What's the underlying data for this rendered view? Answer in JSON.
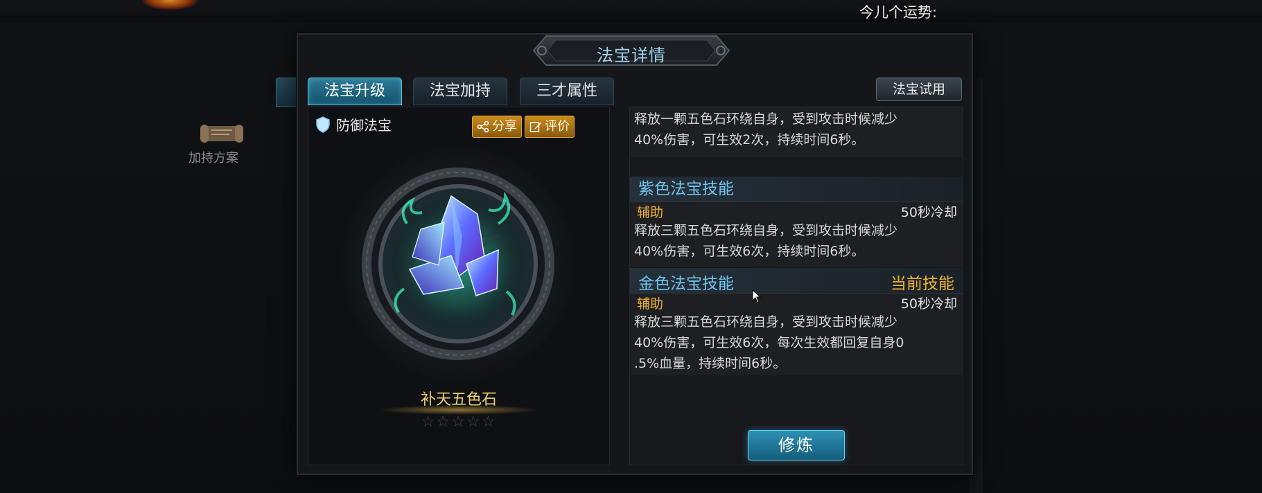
{
  "top_bar": {
    "fortune_label": "今儿个运势:"
  },
  "background": {
    "side_label": "加持方案"
  },
  "modal": {
    "title": "法宝详情",
    "tabs": [
      {
        "label": "法宝升级",
        "active": true
      },
      {
        "label": "法宝加持",
        "active": false
      },
      {
        "label": "三才属性",
        "active": false
      }
    ],
    "trial_button": "法宝试用",
    "treasure": {
      "type": "防御法宝",
      "share_label": "分享",
      "rate_label": "评价",
      "name": "补天五色石",
      "stars": "☆☆☆☆☆",
      "star_rating": 0
    },
    "skills": {
      "partial_desc_line1": "释放一颗五色石环绕自身，受到攻击时候减少",
      "partial_desc_line2": "40%伤害，可生效2次，持续时间6秒。",
      "purple": {
        "title": "紫色法宝技能",
        "category": "辅助",
        "cooldown": "50秒冷却",
        "desc_line1": "释放三颗五色石环绕自身，受到攻击时候减少",
        "desc_line2": "40%伤害，可生效6次，持续时间6秒。"
      },
      "gold": {
        "title": "金色法宝技能",
        "current_label": "当前技能",
        "category": "辅助",
        "cooldown": "50秒冷却",
        "desc_line1": "释放三颗五色石环绕自身，受到攻击时候减少",
        "desc_line2": "40%伤害，可生效6次，每次生效都回复自身0",
        "desc_line3": ".5%血量，持续时间6秒。"
      }
    },
    "cultivate_button": "修炼"
  },
  "colors": {
    "accent_cyan": "#6fc4ec",
    "gold_text": "#f0b030",
    "item_name": "#f0d070"
  }
}
